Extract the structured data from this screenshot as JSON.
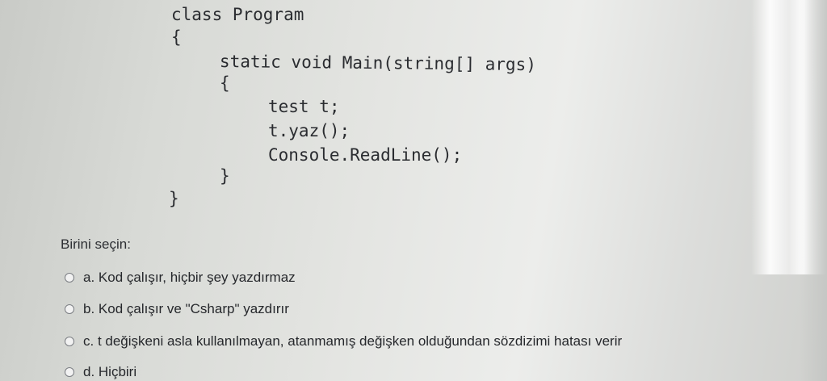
{
  "code": {
    "lines": [
      "class Program",
      "{",
      "static void Main(string[] args)",
      "{",
      "test t;",
      "t.yaz();",
      "Console.ReadLine();",
      "}",
      "}"
    ]
  },
  "question": {
    "prompt": "Birini seçin:",
    "options": [
      "a. Kod çalışır, hiçbir şey yazdırmaz",
      "b. Kod çalışır ve \"Csharp\" yazdırır",
      "c. t değişkeni asla kullanılmayan, atanmamış değişken olduğundan sözdizimi hatası verir",
      "d. Hiçbiri"
    ]
  }
}
